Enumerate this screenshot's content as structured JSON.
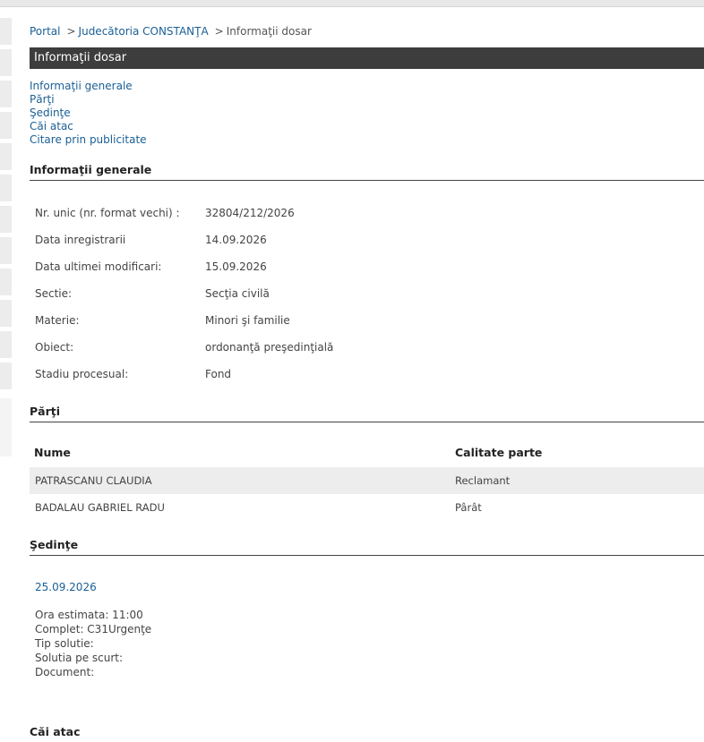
{
  "breadcrumb": {
    "portal": "Portal",
    "sep": ">",
    "court": "Judecătoria CONSTANŢA",
    "current": "Informaţii dosar"
  },
  "title": "Informaţii dosar",
  "toc": [
    "Informaţii generale",
    "Părţi",
    "Şedinţe",
    "Căi atac",
    "Citare prin publicitate"
  ],
  "general": {
    "heading": "Informaţii generale",
    "rows": [
      {
        "label": "Nr. unic (nr. format vechi) :",
        "value": "32804/212/2026"
      },
      {
        "label": "Data inregistrarii",
        "value": "14.09.2026"
      },
      {
        "label": "Data ultimei modificari:",
        "value": "15.09.2026"
      },
      {
        "label": "Sectie:",
        "value": "Secţia civilă"
      },
      {
        "label": "Materie:",
        "value": "Minori şi familie"
      },
      {
        "label": "Obiect:",
        "value": "ordonanţă preşedinţială"
      },
      {
        "label": "Stadiu procesual:",
        "value": "Fond"
      }
    ]
  },
  "parties": {
    "heading": "Părţi",
    "columns": {
      "name": "Nume",
      "role": "Calitate parte"
    },
    "rows": [
      {
        "name": "PATRASCANU CLAUDIA",
        "role": "Reclamant"
      },
      {
        "name": "BADALAU GABRIEL RADU",
        "role": "Pârât"
      }
    ]
  },
  "hearings": {
    "heading": "Şedinţe",
    "date": "25.09.2026",
    "lines": [
      "Ora estimata: 11:00",
      "Complet: C31Urgenţe",
      "Tip solutie:",
      "Solutia pe scurt:",
      "Document:"
    ]
  },
  "appeals": {
    "heading": "Căi atac"
  }
}
